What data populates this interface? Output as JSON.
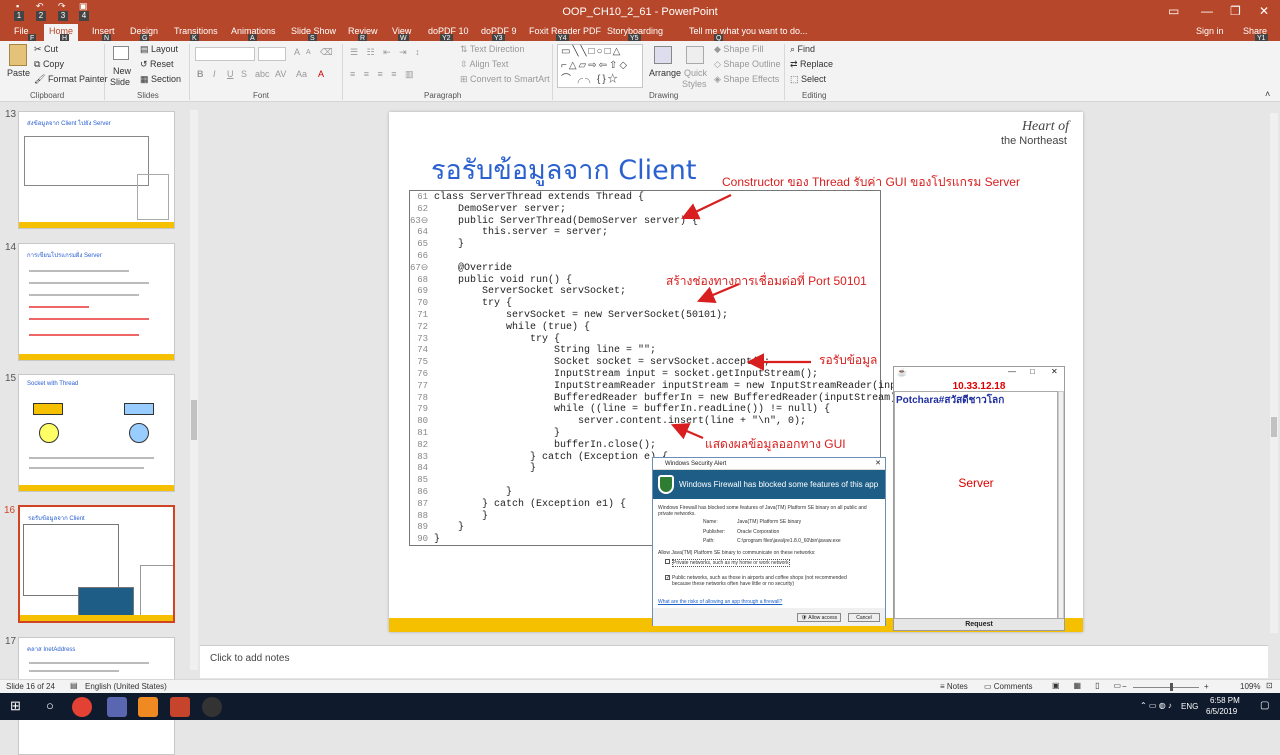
{
  "window": {
    "title": "OOP_CH10_2_61 - PowerPoint",
    "signin": "Sign in",
    "share": "Share",
    "qat_keytips": [
      "1",
      "2",
      "3",
      "4"
    ]
  },
  "tabs": [
    {
      "label": "File",
      "key": "F"
    },
    {
      "label": "Home",
      "key": "H"
    },
    {
      "label": "Insert",
      "key": "N"
    },
    {
      "label": "Design",
      "key": "G"
    },
    {
      "label": "Transitions",
      "key": "K"
    },
    {
      "label": "Animations",
      "key": "A"
    },
    {
      "label": "Slide Show",
      "key": "S"
    },
    {
      "label": "Review",
      "key": "R"
    },
    {
      "label": "View",
      "key": "W"
    },
    {
      "label": "doPDF 10",
      "key": "Y2"
    },
    {
      "label": "doPDF 9",
      "key": "Y3"
    },
    {
      "label": "Foxit Reader PDF",
      "key": "Y4"
    },
    {
      "label": "Storyboarding",
      "key": "Y5"
    },
    {
      "label": "Tell me what you want to do...",
      "key": "Q"
    }
  ],
  "share_key": "Y1",
  "ribbon": {
    "clipboard": {
      "paste": "Paste",
      "cut": "Cut",
      "copy": "Copy",
      "format_painter": "Format Painter",
      "group": "Clipboard"
    },
    "slides": {
      "new_slide": "New",
      "new_slide2": "Slide",
      "layout": "Layout",
      "reset": "Reset",
      "section": "Section",
      "group": "Slides"
    },
    "font": {
      "group": "Font",
      "bold": "B",
      "italic": "I",
      "underline": "U",
      "strike": "S",
      "shadow": "abc",
      "spacing": "AV",
      "case": "Aa",
      "highlight": "A",
      "grow": "A",
      "shrink": "A"
    },
    "paragraph": {
      "text_direction": "Text Direction",
      "align_text": "Align Text",
      "convert_smartart": "Convert to SmartArt",
      "group": "Paragraph"
    },
    "drawing": {
      "arrange": "Arrange",
      "quick_styles": "Quick",
      "quick_styles2": "Styles",
      "shape_fill": "Shape Fill",
      "shape_outline": "Shape Outline",
      "shape_effects": "Shape Effects",
      "group": "Drawing"
    },
    "editing": {
      "find": "Find",
      "replace": "Replace",
      "select": "Select",
      "group": "Editing"
    }
  },
  "thumbnails": [
    {
      "num": "13",
      "title": "ส่งข้อมูลจาก Client ไปยัง Server"
    },
    {
      "num": "14",
      "title": "การเขียนโปรแกรมฝั่ง Server"
    },
    {
      "num": "15",
      "title": "Socket with Thread"
    },
    {
      "num": "16",
      "title": "รอรับข้อมูลจาก Client"
    },
    {
      "num": "17",
      "title": "คลาส InetAddress"
    }
  ],
  "slide": {
    "title": "รอรับข้อมูลจาก Client",
    "brand_line1": "Heart of",
    "brand_line2": "the Northeast",
    "code_lines": [
      {
        "n": "61",
        "t": "class ServerThread extends Thread {"
      },
      {
        "n": "62",
        "t": "    DemoServer server;"
      },
      {
        "n": "63⊖",
        "t": "    public ServerThread(DemoServer server) {"
      },
      {
        "n": "64",
        "t": "        this.server = server;"
      },
      {
        "n": "65",
        "t": "    }"
      },
      {
        "n": "66",
        "t": ""
      },
      {
        "n": "67⊖",
        "t": "    @Override"
      },
      {
        "n": "68",
        "t": "    public void run() {"
      },
      {
        "n": "69",
        "t": "        ServerSocket servSocket;"
      },
      {
        "n": "70",
        "t": "        try {"
      },
      {
        "n": "71",
        "t": "            servSocket = new ServerSocket(50101);"
      },
      {
        "n": "72",
        "t": "            while (true) {"
      },
      {
        "n": "73",
        "t": "                try {"
      },
      {
        "n": "74",
        "t": "                    String line = \"\";"
      },
      {
        "n": "75",
        "t": "                    Socket socket = servSocket.accept();"
      },
      {
        "n": "76",
        "t": "                    InputStream input = socket.getInputStream();"
      },
      {
        "n": "77",
        "t": "                    InputStreamReader inputStream = new InputStreamReader(input);"
      },
      {
        "n": "78",
        "t": "                    BufferedReader bufferIn = new BufferedReader(inputStream);"
      },
      {
        "n": "79",
        "t": "                    while ((line = bufferIn.readLine()) != null) {"
      },
      {
        "n": "80",
        "t": "                        server.content.insert(line + \"\\n\", 0);"
      },
      {
        "n": "81",
        "t": "                    }"
      },
      {
        "n": "82",
        "t": "                    bufferIn.close();"
      },
      {
        "n": "83",
        "t": "                } catch (Exception e) {"
      },
      {
        "n": "84",
        "t": "                }"
      },
      {
        "n": "85",
        "t": ""
      },
      {
        "n": "86",
        "t": "            }"
      },
      {
        "n": "87",
        "t": "        } catch (Exception e1) {"
      },
      {
        "n": "88",
        "t": "        }"
      },
      {
        "n": "89",
        "t": "    }"
      },
      {
        "n": "90",
        "t": "}"
      }
    ],
    "annotations": {
      "constructor": "Constructor ของ Thread รับค่า GUI ของโปรแกรม Server",
      "channel": "สร้างช่องทางการเชื่อมต่อที่ Port 50101",
      "receive": "รอรับข้อมูล",
      "display": "แสดงผลข้อมูลออกทาง GUI"
    }
  },
  "server_window": {
    "ip": "10.33.12.18",
    "message": "Potchara#สวัสดีชาวโลก",
    "label": "Server",
    "request_button": "Request"
  },
  "security_alert": {
    "title": "Windows Security Alert",
    "banner": "Windows Firewall has blocked some features of this app",
    "desc1": "Windows Firewall has blocked some features of Java(TM) Platform SE binary on all public and",
    "desc2": "private networks.",
    "name_label": "Name:",
    "name_value": "Java(TM) Platform SE binary",
    "publisher_label": "Publisher:",
    "publisher_value": "Oracle Corporation",
    "path_label": "Path:",
    "path_value": "C:\\program files\\java\\jre1.8.0_60\\bin\\javaw.exe",
    "allow_text": "Allow Java(TM) Platform SE binary to communicate on these networks:",
    "private_opt": "Private networks, such as my home or work network",
    "public_opt1": "Public networks, such as those in airports and coffee shops (not recommended",
    "public_opt2": "because these networks often have little or no security)",
    "link": "What are the risks of allowing an app through a firewall?",
    "allow_btn": "Allow access",
    "cancel_btn": "Cancel"
  },
  "notes_placeholder": "Click to add notes",
  "status": {
    "slide_of": "Slide 16 of 24",
    "language": "English (United States)",
    "notes": "Notes",
    "comments": "Comments",
    "zoom": "109%"
  },
  "taskbar": {
    "lang": "ENG",
    "time": "6:58 PM",
    "date": "6/5/2019"
  },
  "colors": {
    "accent": "#b7472a",
    "slide_title": "#2a60d0",
    "annotation": "#d81e1e",
    "yellow_bar": "#f5c000"
  }
}
